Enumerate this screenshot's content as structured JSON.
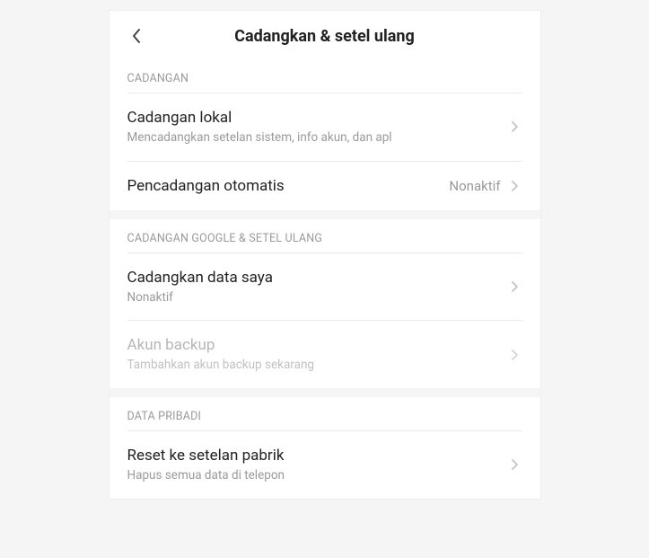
{
  "header": {
    "title": "Cadangkan & setel ulang"
  },
  "sections": {
    "cadangan": {
      "header": "CADANGAN",
      "local_backup": {
        "title": "Cadangan lokal",
        "sub": "Mencadangkan setelan sistem, info akun, dan apl"
      },
      "auto_backup": {
        "title": "Pencadangan otomatis",
        "value": "Nonaktif"
      }
    },
    "google": {
      "header": "CADANGAN GOOGLE & SETEL ULANG",
      "backup_my_data": {
        "title": "Cadangkan data saya",
        "sub": "Nonaktif"
      },
      "backup_account": {
        "title": "Akun backup",
        "sub": "Tambahkan akun backup sekarang"
      }
    },
    "personal": {
      "header": "DATA PRIBADI",
      "factory_reset": {
        "title": "Reset ke setelan pabrik",
        "sub": "Hapus semua data di telepon"
      }
    }
  }
}
